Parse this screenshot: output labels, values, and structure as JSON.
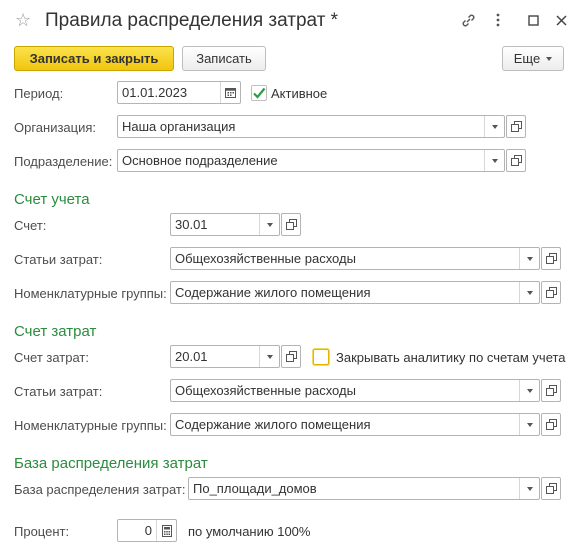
{
  "window": {
    "title": "Правила распределения затрат *"
  },
  "toolbar": {
    "save_close_label": "Записать и закрыть",
    "save_label": "Записать",
    "more_label": "Еще"
  },
  "header_fields": {
    "period_label": "Период:",
    "period_value": "01.01.2023",
    "active_label": "Активное",
    "active_checked": true,
    "org_label": "Организация:",
    "org_value": "Наша организация",
    "dept_label": "Подразделение:",
    "dept_value": "Основное подразделение"
  },
  "account_section": {
    "title": "Счет учета",
    "account_label": "Счет:",
    "account_value": "30.01",
    "cost_items_label": "Статьи затрат:",
    "cost_items_value": "Общехозяйственные расходы",
    "nom_groups_label": "Номенклатурные группы:",
    "nom_groups_value": "Содержание жилого помещения"
  },
  "cost_account_section": {
    "title": "Счет затрат",
    "account_label": "Счет затрат:",
    "account_value": "20.01",
    "close_analytics_label": "Закрывать аналитику по счетам учета",
    "close_analytics_checked": false,
    "cost_items_label": "Статьи затрат:",
    "cost_items_value": "Общехозяйственные расходы",
    "nom_groups_label": "Номенклатурные группы:",
    "nom_groups_value": "Содержание жилого помещения"
  },
  "distribution_section": {
    "title": "База распределения затрат",
    "base_label": "База распределения затрат:",
    "base_value": "По_площади_домов",
    "percent_label": "Процент:",
    "percent_value": "0",
    "percent_default_note": "по умолчанию 100%"
  },
  "colors": {
    "primary_button": "#f4cf1a",
    "section_title": "#2c8c3e",
    "check_green": "#2e9b47"
  }
}
